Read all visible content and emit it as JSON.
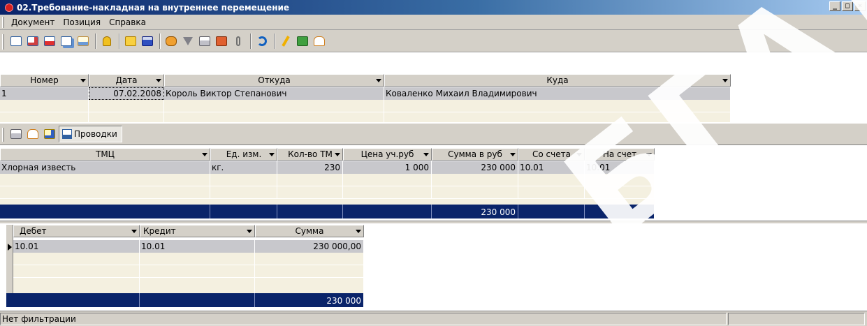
{
  "window": {
    "title": "02.Требование-накладная на внутреннее перемещение",
    "btn_min": "_",
    "btn_max": "□",
    "btn_close": "×"
  },
  "menu": {
    "items": [
      "Документ",
      "Позиция",
      "Справка"
    ]
  },
  "toolbar": {
    "icons": [
      "new-doc-icon",
      "edit-doc-icon",
      "delete-doc-icon",
      "copy-doc-icon",
      "mail-doc-icon",
      "lock-icon",
      "open-folder-icon",
      "save-icon",
      "find-icon",
      "filter-icon",
      "print-icon",
      "stamp-icon",
      "attach-icon",
      "refresh-icon",
      "execute-icon",
      "money-icon",
      "book-icon"
    ]
  },
  "documents": {
    "headers": [
      "Номер",
      "Дата",
      "Откуда",
      "Куда"
    ],
    "rows": [
      {
        "number": "1",
        "date": "07.02.2008",
        "from": "Король Виктор Степанович",
        "to": "Коваленко Михаил Владимирович"
      }
    ]
  },
  "subtoolbar": {
    "provodki_label": "Проводки"
  },
  "positions": {
    "headers": [
      "ТМЦ",
      "Ед. изм.",
      "Кол-во ТМ",
      "Цена уч.руб",
      "Сумма в руб",
      "Со счета",
      "На счет"
    ],
    "rows": [
      {
        "tmc": "Хлорная известь",
        "unit": "кг.",
        "qty": "230",
        "price": "1 000",
        "sum": "230 000",
        "from_acc": "10.01",
        "to_acc": "10.01"
      }
    ],
    "total_sum": "230 000"
  },
  "entries": {
    "headers": [
      "Дебет",
      "Кредит",
      "Сумма"
    ],
    "rows": [
      {
        "debit": "10.01",
        "credit": "10.01",
        "sum": "230 000,00"
      }
    ],
    "total_sum": "230 000"
  },
  "status": {
    "text": "Нет фильтрации"
  },
  "watermark": {
    "text": "БГАТУ"
  },
  "colors": {
    "selected_row": "#c8c8cc",
    "empty_row": "#f4f0e0",
    "total_row": "#0a246a",
    "face": "#d4d0c8"
  }
}
